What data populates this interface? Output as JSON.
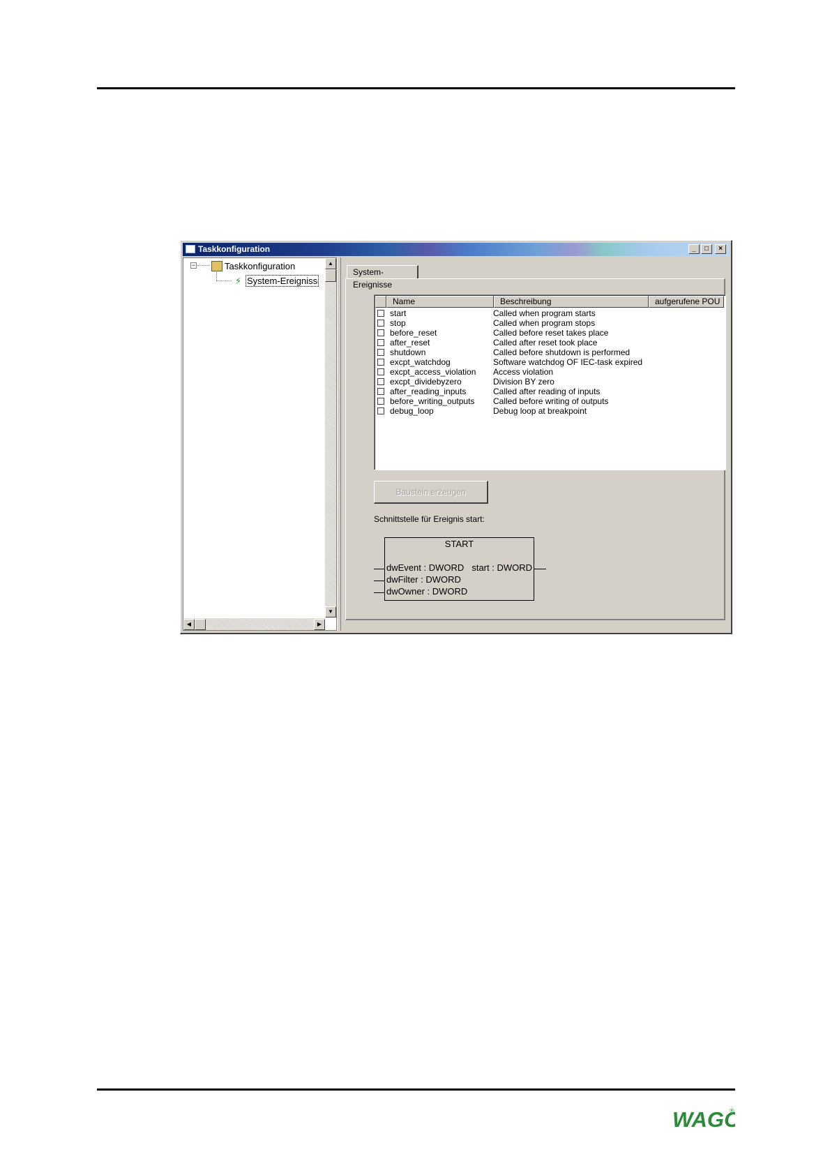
{
  "window": {
    "title": "Taskkonfiguration",
    "minimize": "_",
    "maximize": "□",
    "close": "×"
  },
  "tree": {
    "root_label": "Taskkonfiguration",
    "child_label": "System-Ereignisse",
    "expander": "−"
  },
  "tab": {
    "label": "System-Ereignisse"
  },
  "events_table": {
    "columns": [
      "Name",
      "Beschreibung",
      "aufgerufene POU"
    ],
    "rows": [
      {
        "name": "start",
        "description": "Called when program starts"
      },
      {
        "name": "stop",
        "description": "Called when program stops"
      },
      {
        "name": "before_reset",
        "description": "Called before reset takes place"
      },
      {
        "name": "after_reset",
        "description": "Called after reset took place"
      },
      {
        "name": "shutdown",
        "description": "Called before shutdown is performed"
      },
      {
        "name": "excpt_watchdog",
        "description": "Software watchdog OF IEC-task expired"
      },
      {
        "name": "excpt_access_violation",
        "description": "Access violation"
      },
      {
        "name": "excpt_dividebyzero",
        "description": "Division BY zero"
      },
      {
        "name": "after_reading_inputs",
        "description": "Called after reading of inputs"
      },
      {
        "name": "before_writing_outputs",
        "description": "Called before writing of outputs"
      },
      {
        "name": "debug_loop",
        "description": "Debug loop at breakpoint"
      }
    ]
  },
  "create_button": {
    "label": "Baustein erzeugen"
  },
  "interface_label": "Schnittstelle für Ereignis start:",
  "function_block": {
    "title": "START",
    "inputs": [
      "dwEvent : DWORD",
      "dwFilter : DWORD",
      "dwOwner : DWORD"
    ],
    "output": "start : DWORD"
  },
  "logo": {
    "text": "WAGO",
    "registered": "®",
    "color": "#2d8a3a"
  }
}
